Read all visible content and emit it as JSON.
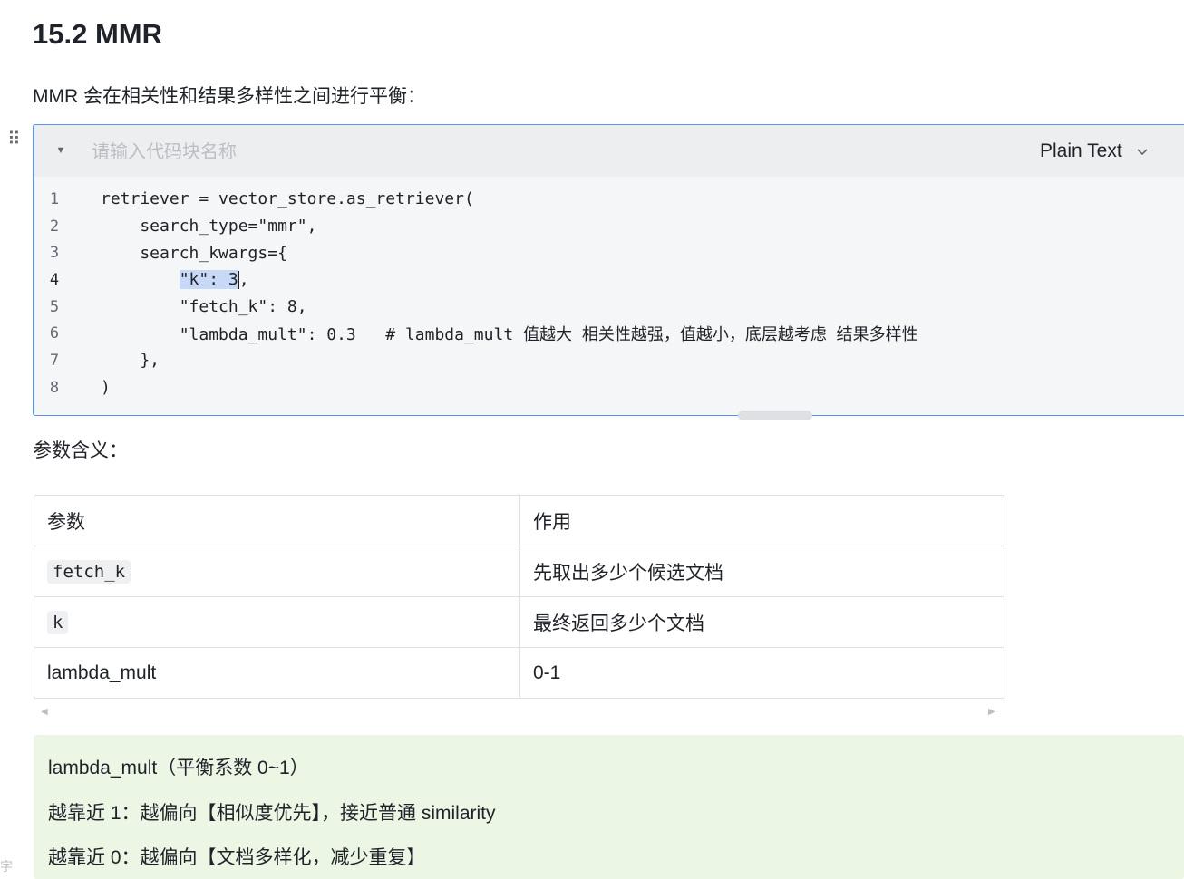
{
  "doc": {
    "heading": "15.2 MMR",
    "intro": "MMR 会在相关性和结果多样性之间进行平衡：",
    "edge_char": "字"
  },
  "code_block": {
    "name_placeholder": "请输入代码块名称",
    "language": "Plain Text",
    "lines": [
      {
        "num": "1",
        "pre": "retriever = vector_store.as_retriever(",
        "sel": "",
        "post": ""
      },
      {
        "num": "2",
        "pre": "    search_type=\"mmr\",",
        "sel": "",
        "post": ""
      },
      {
        "num": "3",
        "pre": "    search_kwargs={",
        "sel": "",
        "post": ""
      },
      {
        "num": "4",
        "pre": "        ",
        "sel": "\"k\": 3",
        "post": ","
      },
      {
        "num": "5",
        "pre": "        \"fetch_k\": 8,",
        "sel": "",
        "post": ""
      },
      {
        "num": "6",
        "pre": "        \"lambda_mult\": 0.3   # lambda_mult 值越大 相关性越强，值越小，底层越考虑 结果多样性",
        "sel": "",
        "post": ""
      },
      {
        "num": "7",
        "pre": "    },",
        "sel": "",
        "post": ""
      },
      {
        "num": "8",
        "pre": ")",
        "sel": "",
        "post": ""
      }
    ],
    "active_line": "4"
  },
  "params": {
    "title": "参数含义：",
    "headers": [
      "参数",
      "作用"
    ],
    "rows": [
      {
        "param": "fetch_k",
        "desc": "先取出多少个候选文档"
      },
      {
        "param": "k",
        "desc": "最终返回多少个文档"
      },
      {
        "param": "lambda_mult",
        "desc": "0-1"
      }
    ]
  },
  "callout": {
    "line1": "lambda_mult（平衡系数 0~1）",
    "line2": "越靠近 1：越偏向【相似度优先】，接近普通 similarity",
    "line3": "越靠近 0：越偏向【文档多样化，减少重复】"
  },
  "colors": {
    "accent": "#5b8ff9",
    "selection": "#c7d9f7",
    "callout_bg": "#ebf6e4"
  }
}
